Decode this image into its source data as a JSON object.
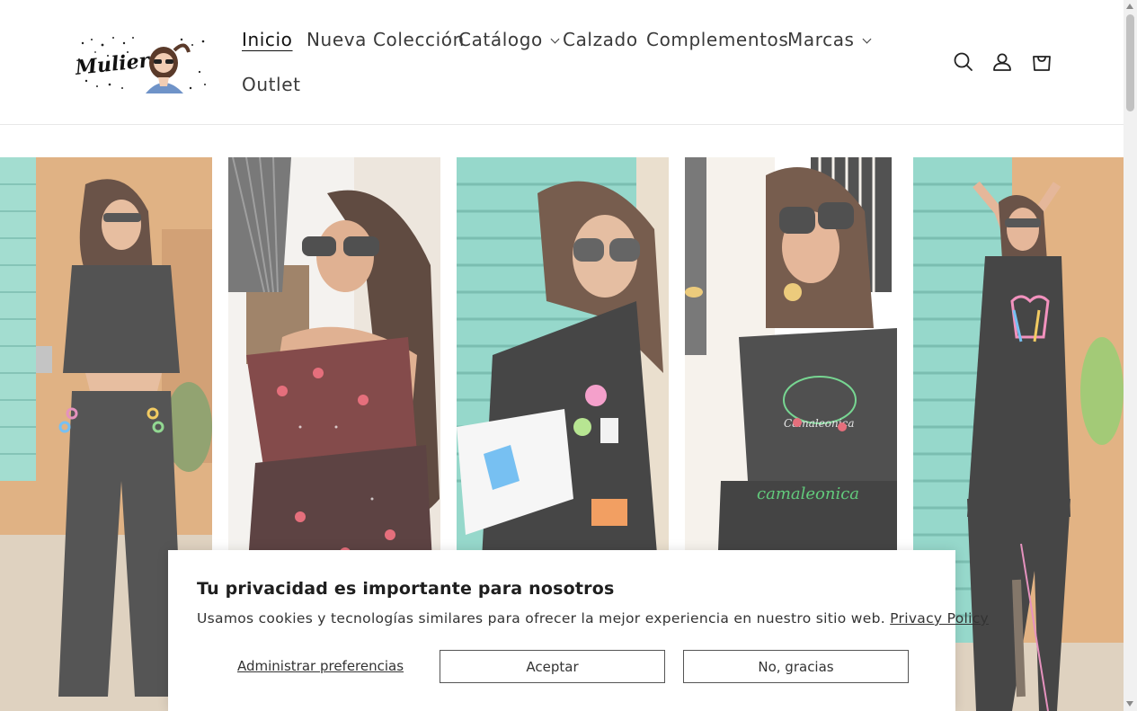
{
  "header": {
    "logo_text": "Mulier",
    "nav": [
      {
        "label": "Inicio",
        "active": true,
        "has_dropdown": false
      },
      {
        "label": "Nueva Colección",
        "active": false,
        "has_dropdown": false
      },
      {
        "label": "Catálogo",
        "active": false,
        "has_dropdown": true
      },
      {
        "label": "Calzado",
        "active": false,
        "has_dropdown": false
      },
      {
        "label": "Complementos",
        "active": false,
        "has_dropdown": false
      },
      {
        "label": "Marcas",
        "active": false,
        "has_dropdown": true
      },
      {
        "label": "Outlet",
        "active": false,
        "has_dropdown": false
      }
    ],
    "icons": [
      "search-icon",
      "account-icon",
      "cart-icon"
    ]
  },
  "gallery": {
    "photos": [
      {
        "name": "model-black-crop-top-wide-pants"
      },
      {
        "name": "model-floral-ruffle-dress-fan"
      },
      {
        "name": "model-black-blazer-patches"
      },
      {
        "name": "model-black-tee-camaleonica"
      },
      {
        "name": "model-black-long-dress-wings"
      }
    ]
  },
  "cookie_banner": {
    "title": "Tu privacidad es importante para nosotros",
    "text": "Usamos cookies y tecnologías similares para ofrecer la mejor experiencia en nuestro sitio web.",
    "policy_link": "Privacy Policy",
    "manage_label": "Administrar preferencias",
    "accept_label": "Aceptar",
    "decline_label": "No, gracias"
  },
  "colors": {
    "text": "#121212",
    "border": "#555555",
    "wall_orange": "#d9995c",
    "shutter_teal": "#7fd0c0"
  }
}
